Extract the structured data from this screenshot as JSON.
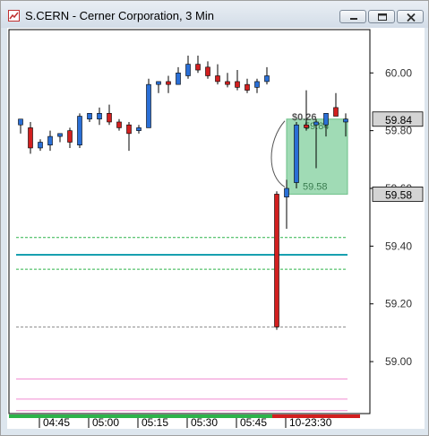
{
  "window": {
    "title": "S.CERN - Cerner Corporation, 3 Min",
    "minimize_label": "minimize",
    "maximize_label": "maximize",
    "close_label": "close"
  },
  "colors": {
    "up": "#2a6fd6",
    "down": "#d21f1f",
    "box": "#8fd5a8",
    "green_line": "#2db34a",
    "teal_line": "#18a0b0",
    "pink_line": "#f08ad0",
    "gray_line": "#909090"
  },
  "chart_data": {
    "type": "candlestick",
    "ylim": [
      58.82,
      60.15
    ],
    "y_ticks": [
      "60.00",
      "59.80",
      "59.60",
      "59.40",
      "59.20",
      "59.00"
    ],
    "x_ticks": [
      "04:45",
      "05:00",
      "05:15",
      "05:30",
      "05:45",
      "10-23:30"
    ],
    "price_tags": [
      "59.84",
      "59.58"
    ],
    "candles": [
      {
        "o": 59.82,
        "h": 59.84,
        "l": 59.79,
        "c": 59.84
      },
      {
        "o": 59.81,
        "h": 59.83,
        "l": 59.72,
        "c": 59.74
      },
      {
        "o": 59.74,
        "h": 59.77,
        "l": 59.73,
        "c": 59.76
      },
      {
        "o": 59.75,
        "h": 59.8,
        "l": 59.73,
        "c": 59.78
      },
      {
        "o": 59.78,
        "h": 59.79,
        "l": 59.76,
        "c": 59.79
      },
      {
        "o": 59.8,
        "h": 59.81,
        "l": 59.74,
        "c": 59.76
      },
      {
        "o": 59.75,
        "h": 59.86,
        "l": 59.74,
        "c": 59.85
      },
      {
        "o": 59.84,
        "h": 59.86,
        "l": 59.83,
        "c": 59.86
      },
      {
        "o": 59.84,
        "h": 59.88,
        "l": 59.82,
        "c": 59.86
      },
      {
        "o": 59.86,
        "h": 59.89,
        "l": 59.82,
        "c": 59.83
      },
      {
        "o": 59.83,
        "h": 59.84,
        "l": 59.8,
        "c": 59.81
      },
      {
        "o": 59.82,
        "h": 59.83,
        "l": 59.73,
        "c": 59.79
      },
      {
        "o": 59.8,
        "h": 59.82,
        "l": 59.79,
        "c": 59.81
      },
      {
        "o": 59.81,
        "h": 59.98,
        "l": 59.81,
        "c": 59.96
      },
      {
        "o": 59.96,
        "h": 59.97,
        "l": 59.93,
        "c": 59.97
      },
      {
        "o": 59.97,
        "h": 59.99,
        "l": 59.93,
        "c": 59.96
      },
      {
        "o": 59.96,
        "h": 60.02,
        "l": 59.96,
        "c": 60.0
      },
      {
        "o": 59.99,
        "h": 60.06,
        "l": 59.98,
        "c": 60.03
      },
      {
        "o": 60.03,
        "h": 60.06,
        "l": 60.0,
        "c": 60.01
      },
      {
        "o": 60.02,
        "h": 60.04,
        "l": 59.98,
        "c": 59.99
      },
      {
        "o": 59.99,
        "h": 60.03,
        "l": 59.96,
        "c": 59.97
      },
      {
        "o": 59.97,
        "h": 60.0,
        "l": 59.95,
        "c": 59.96
      },
      {
        "o": 59.97,
        "h": 60.01,
        "l": 59.94,
        "c": 59.95
      },
      {
        "o": 59.96,
        "h": 59.98,
        "l": 59.93,
        "c": 59.94
      },
      {
        "o": 59.95,
        "h": 59.98,
        "l": 59.93,
        "c": 59.97
      },
      {
        "o": 59.97,
        "h": 60.02,
        "l": 59.96,
        "c": 59.99
      },
      {
        "o": 59.58,
        "h": 59.59,
        "l": 59.11,
        "c": 59.12
      },
      {
        "o": 59.57,
        "h": 59.63,
        "l": 59.46,
        "c": 59.6
      },
      {
        "o": 59.62,
        "h": 59.83,
        "l": 59.6,
        "c": 59.82
      },
      {
        "o": 59.82,
        "h": 59.94,
        "l": 59.8,
        "c": 59.81
      },
      {
        "o": 59.82,
        "h": 59.84,
        "l": 59.67,
        "c": 59.83
      },
      {
        "o": 59.82,
        "h": 59.86,
        "l": 59.78,
        "c": 59.86
      },
      {
        "o": 59.88,
        "h": 59.93,
        "l": 59.85,
        "c": 59.85
      },
      {
        "o": 59.83,
        "h": 59.86,
        "l": 59.78,
        "c": 59.84
      }
    ],
    "levels": [
      {
        "name": "upper-green-line",
        "value": 59.43,
        "style": "dashed",
        "color": "green_line"
      },
      {
        "name": "teal-line",
        "value": 59.37,
        "style": "solid",
        "color": "teal_line"
      },
      {
        "name": "lower-green-line",
        "value": 59.32,
        "style": "dashed",
        "color": "green_line"
      },
      {
        "name": "gray-line",
        "value": 59.12,
        "style": "dashed",
        "color": "gray_line"
      },
      {
        "name": "pink-line-1",
        "value": 58.94,
        "style": "solid",
        "color": "pink_line"
      },
      {
        "name": "pink-line-2",
        "value": 58.87,
        "style": "solid",
        "color": "pink_line"
      },
      {
        "name": "pink-line-3",
        "value": 58.83,
        "style": "solid",
        "color": "pink_line"
      }
    ],
    "box": {
      "from_index": 27,
      "to_index": 33,
      "top": 59.84,
      "bottom": 59.58,
      "label_top": "$0.26",
      "label_mid": "59.84",
      "label_bottom": "59.58"
    }
  }
}
